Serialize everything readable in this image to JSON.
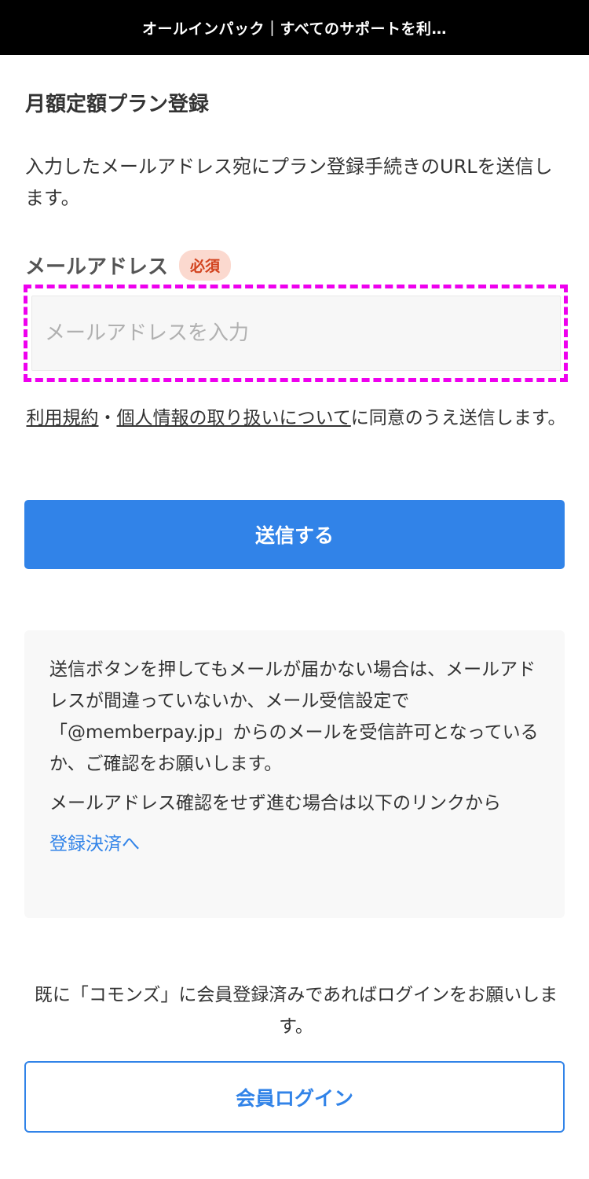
{
  "header": {
    "title": "オールインパック｜すべてのサポートを利…"
  },
  "form": {
    "title": "月額定額プラン登録",
    "description": "入力したメールアドレス宛にプラン登録手続きのURLを送信します。",
    "email_label": "メールアドレス",
    "required_badge": "必須",
    "email_placeholder": "メールアドレスを入力",
    "email_value": "",
    "consent": {
      "terms_link": "利用規約",
      "separator": "・",
      "privacy_link": "個人情報の取り扱いについて",
      "suffix": "に同意のうえ送信します。"
    },
    "submit_label": "送信する"
  },
  "notice": {
    "paragraph1": "送信ボタンを押してもメールが届かない場合は、メールアドレスが間違っていないか、メール受信設定で「@memberpay.jp」からのメールを受信許可となっているか、ご確認をお願いします。",
    "paragraph2": "メールアドレス確認をせず進む場合は以下のリンクから",
    "link": "登録決済へ"
  },
  "login": {
    "note": "既に「コモンズ」に会員登録済みであればログインをお願いします。",
    "button_label": "会員ログイン"
  },
  "colors": {
    "primary": "#3183e8",
    "header_bg": "#000000",
    "required_bg": "#fbd9cf",
    "required_text": "#d2431f",
    "highlight": "#ee00ee"
  }
}
